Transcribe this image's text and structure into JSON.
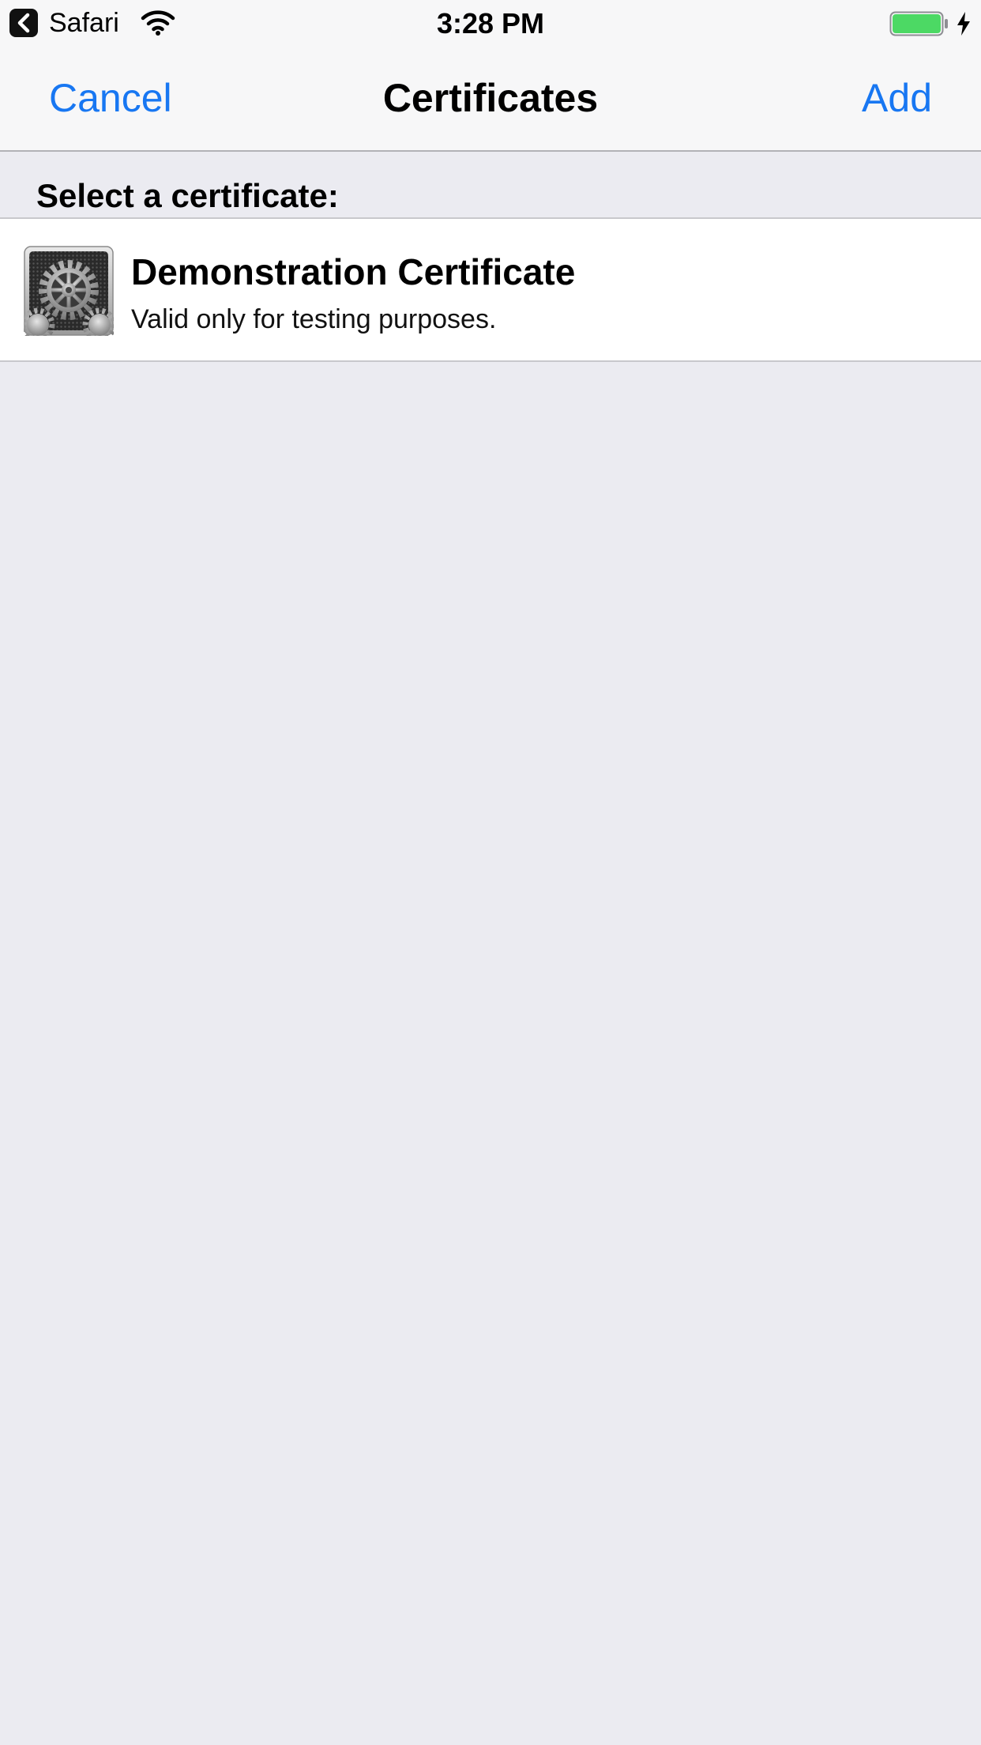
{
  "status_bar": {
    "back_app": "Safari",
    "time": "3:28 PM",
    "icons": [
      "back-arrow-icon",
      "wifi-icon",
      "battery-icon",
      "charging-bolt-icon"
    ],
    "battery_level_percent": 100,
    "battery_color": "#4cd964"
  },
  "nav": {
    "cancel_label": "Cancel",
    "title": "Certificates",
    "add_label": "Add",
    "accent_color": "#1877f2"
  },
  "section": {
    "header": "Select a certificate:"
  },
  "certificates": [
    {
      "title": "Demonstration Certificate",
      "subtitle": "Valid only for testing purposes.",
      "icon": "settings-gear-icon"
    }
  ]
}
